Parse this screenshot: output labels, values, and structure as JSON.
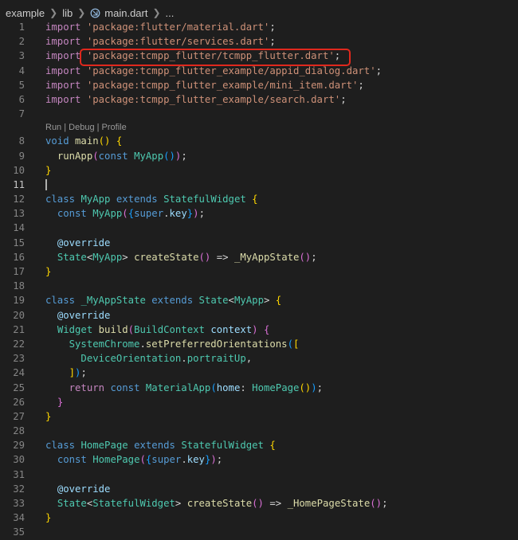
{
  "breadcrumb": {
    "folder1": "example",
    "folder2": "lib",
    "file": "main.dart",
    "more": "..."
  },
  "codelens": "Run | Debug | Profile",
  "colors": {
    "background": "#1e1e1e",
    "highlight_box": "#e0281d",
    "keyword": "#569cd6",
    "string": "#ce9178",
    "class": "#4ec9b0"
  },
  "lines": {
    "n1": "1",
    "n2": "2",
    "n3": "3",
    "n4": "4",
    "n5": "5",
    "n6": "6",
    "n7": "7",
    "n8": "8",
    "n9": "9",
    "n10": "10",
    "n11": "11",
    "n12": "12",
    "n13": "13",
    "n14": "14",
    "n15": "15",
    "n16": "16",
    "n17": "17",
    "n18": "18",
    "n19": "19",
    "n20": "20",
    "n21": "21",
    "n22": "22",
    "n23": "23",
    "n24": "24",
    "n25": "25",
    "n26": "26",
    "n27": "27",
    "n28": "28",
    "n29": "29",
    "n30": "30",
    "n31": "31",
    "n32": "32",
    "n33": "33",
    "n34": "34",
    "n35": "35"
  },
  "tokens": {
    "import": "import",
    "imp1": "'package:flutter/material.dart'",
    "imp2": "'package:flutter/services.dart'",
    "imp3": "'package:tcmpp_flutter/tcmpp_flutter.dart'",
    "imp4": "'package:tcmpp_flutter_example/appid_dialog.dart'",
    "imp5": "'package:tcmpp_flutter_example/mini_item.dart'",
    "imp6": "'package:tcmpp_flutter_example/search.dart'",
    "semi": ";",
    "void": "void",
    "main": "main",
    "runApp": "runApp",
    "const": "const",
    "MyApp": "MyApp",
    "class": "class",
    "extends": "extends",
    "StatefulWidget": "StatefulWidget",
    "super": "super",
    "key": "key",
    "override": "@override",
    "State": "State",
    "createState": "createState",
    "arrow": "=>",
    "MyAppState": "_MyAppState",
    "Widget": "Widget",
    "build": "build",
    "BuildContext": "BuildContext",
    "context": "context",
    "SystemChrome": "SystemChrome",
    "setPreferredOrientations": "setPreferredOrientations",
    "DeviceOrientation": "DeviceOrientation",
    "portraitUp": "portraitUp",
    "return": "return",
    "MaterialApp": "MaterialApp",
    "home": "home",
    "HomePage": "HomePage",
    "HomePageState": "_HomePageState"
  }
}
